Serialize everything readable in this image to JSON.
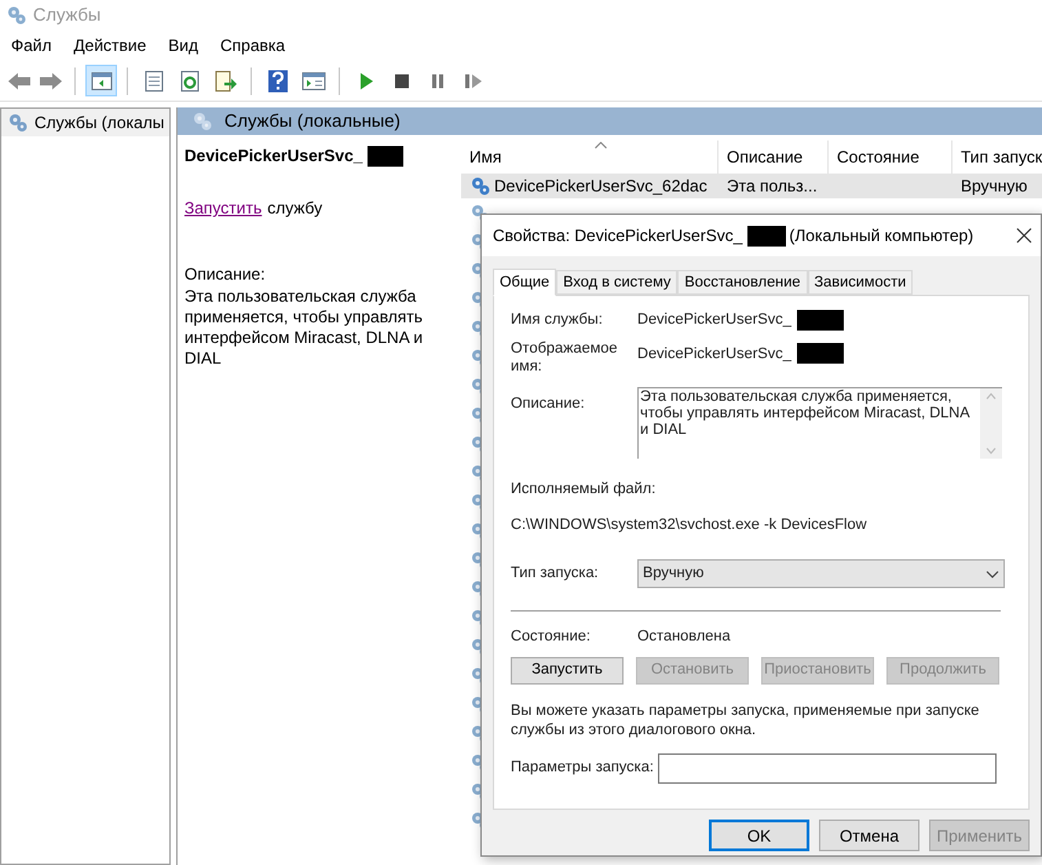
{
  "window": {
    "title": "Службы"
  },
  "menu": [
    "Файл",
    "Действие",
    "Вид",
    "Справка"
  ],
  "toolbar": [
    {
      "kind": "back",
      "disabled": true
    },
    {
      "kind": "forward",
      "disabled": true
    },
    {
      "kind": "sep"
    },
    {
      "kind": "tree",
      "selected": true
    },
    {
      "kind": "sep"
    },
    {
      "kind": "props",
      "selected": false
    },
    {
      "kind": "refresh",
      "selected": false
    },
    {
      "kind": "export",
      "selected": false
    },
    {
      "kind": "sep"
    },
    {
      "kind": "help",
      "selected": false
    },
    {
      "kind": "view",
      "selected": false
    },
    {
      "kind": "sep"
    },
    {
      "kind": "play",
      "disabled": false
    },
    {
      "kind": "stop",
      "disabled": false
    },
    {
      "kind": "pause",
      "disabled": false
    },
    {
      "kind": "resume",
      "disabled": false
    }
  ],
  "tree": {
    "items": [
      {
        "label": "Службы (локалы",
        "selected": false
      }
    ]
  },
  "pane": {
    "title": "Службы (локальные)",
    "service_name": "DevicePickerUserSvc_",
    "name_redacted": true,
    "action_link": "Запустить",
    "action_rest": "службу",
    "description_label": "Описание:",
    "description": "Эта пользовательская служба применяется, чтобы управлять интерфейсом Miracast, DLNA и DIAL"
  },
  "list": {
    "columns": [
      "Имя",
      "Описание",
      "Состояние",
      "Тип запуск"
    ],
    "rows": [
      {
        "cells": [
          "DevicePickerUserSvc_62dac",
          "Эта польз...",
          "",
          "Вручную"
        ],
        "selected": true
      }
    ]
  },
  "dialog": {
    "title_prefix": "Свойства: DevicePickerUserSvc_",
    "title_redacted": true,
    "title_suffix": "(Локальный компьютер)",
    "tabs": [
      {
        "label": "Общие",
        "selected": true
      },
      {
        "label": "Вход в систему",
        "selected": false
      },
      {
        "label": "Восстановление",
        "selected": false
      },
      {
        "label": "Зависимости",
        "selected": false
      }
    ],
    "service_name_label": "Имя службы:",
    "service_name": "DevicePickerUserSvc_",
    "service_name_redacted": true,
    "display_name_label": "Отображаемое имя:",
    "display_name": "DevicePickerUserSvc_",
    "display_name_redacted": true,
    "description_label": "Описание:",
    "description": "Эта пользовательская служба применяется, чтобы управлять интерфейсом Miracast, DLNA и DIAL",
    "exe_label": "Исполняемый файл:",
    "exe_path": "C:\\WINDOWS\\system32\\svchost.exe -k DevicesFlow",
    "startup_label": "Тип запуска:",
    "startup_value": "Вручную",
    "state_label": "Состояние:",
    "state_value": "Остановлена",
    "state_buttons": [
      {
        "label": "Запустить",
        "disabled": false
      },
      {
        "label": "Остановить",
        "disabled": true
      },
      {
        "label": "Приостановить",
        "disabled": true
      },
      {
        "label": "Продолжить",
        "disabled": true
      }
    ],
    "hint": "Вы можете указать параметры запуска, применяемые при запуске службы из этого диалогового окна.",
    "params_label": "Параметры запуска:",
    "buttons": [
      {
        "label": "OK",
        "default": true,
        "disabled": false
      },
      {
        "label": "Отмена",
        "default": false,
        "disabled": false
      },
      {
        "label": "Применить",
        "default": false,
        "disabled": true
      }
    ]
  }
}
